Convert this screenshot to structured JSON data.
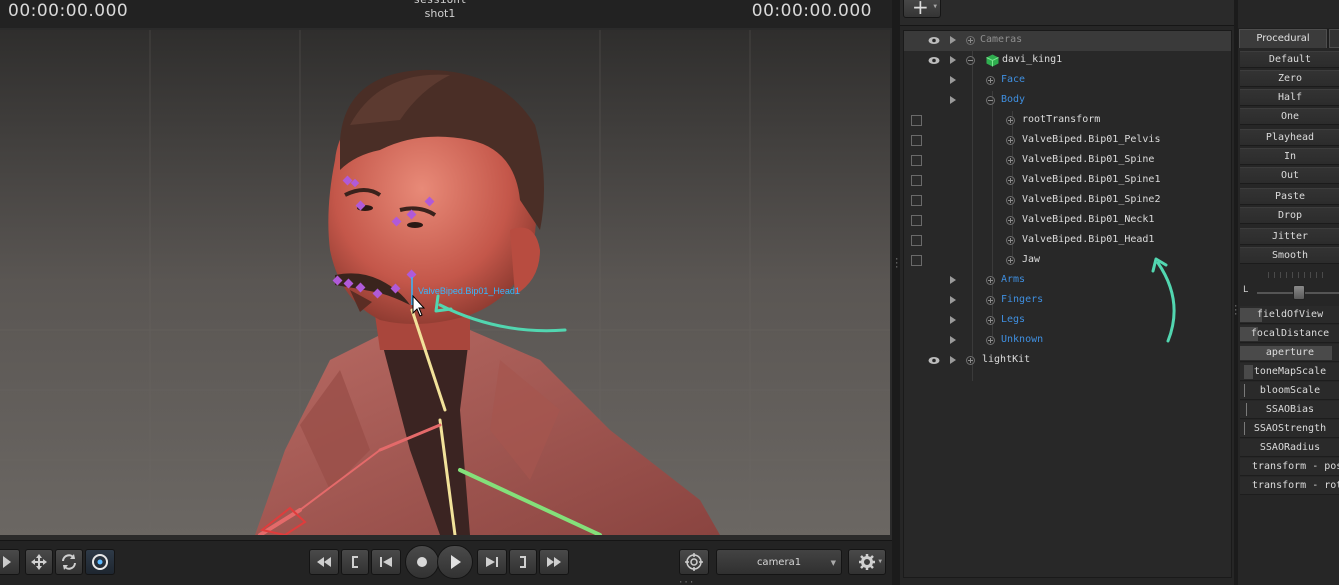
{
  "viewport": {
    "timecode_left": "00:00:00.000",
    "timecode_right": "00:00:00.000",
    "session_name": "sessionl",
    "shot_name": "shot1",
    "bone_label": "ValveBiped.Bip01_Head1",
    "toolbar": {
      "camera_select": "camera1"
    }
  },
  "outliner": {
    "rows": [
      {
        "label": "Cameras"
      },
      {
        "label": "davi_king1"
      },
      {
        "label": "Face"
      },
      {
        "label": "Body"
      },
      {
        "label": "rootTransform"
      },
      {
        "label": "ValveBiped.Bip01_Pelvis"
      },
      {
        "label": "ValveBiped.Bip01_Spine"
      },
      {
        "label": "ValveBiped.Bip01_Spine1"
      },
      {
        "label": "ValveBiped.Bip01_Spine2"
      },
      {
        "label": "ValveBiped.Bip01_Neck1"
      },
      {
        "label": "ValveBiped.Bip01_Head1"
      },
      {
        "label": "Jaw"
      },
      {
        "label": "Arms"
      },
      {
        "label": "Fingers"
      },
      {
        "label": "Legs"
      },
      {
        "label": "Unknown"
      },
      {
        "label": "lightKit"
      }
    ]
  },
  "procedural": {
    "tab_label": "Procedural",
    "buttons": [
      "Default",
      "Zero",
      "Half",
      "One",
      "Playhead",
      "In",
      "Out",
      "Paste",
      "Drop",
      "Jitter",
      "Smooth"
    ],
    "slider_label": "L",
    "properties": [
      "fieldOfView",
      "focalDistance",
      "aperture",
      "toneMapScale",
      "bloomScale",
      "SSAOBias",
      "SSAOStrength",
      "SSAORadius",
      "transform - pos",
      "transform - rot"
    ]
  },
  "colors": {
    "accent_blue": "#3f8fe0",
    "annotation_arrow": "#52d6b0",
    "bone_marker": "#b05ad8",
    "bone_label": "#35b8ff"
  }
}
